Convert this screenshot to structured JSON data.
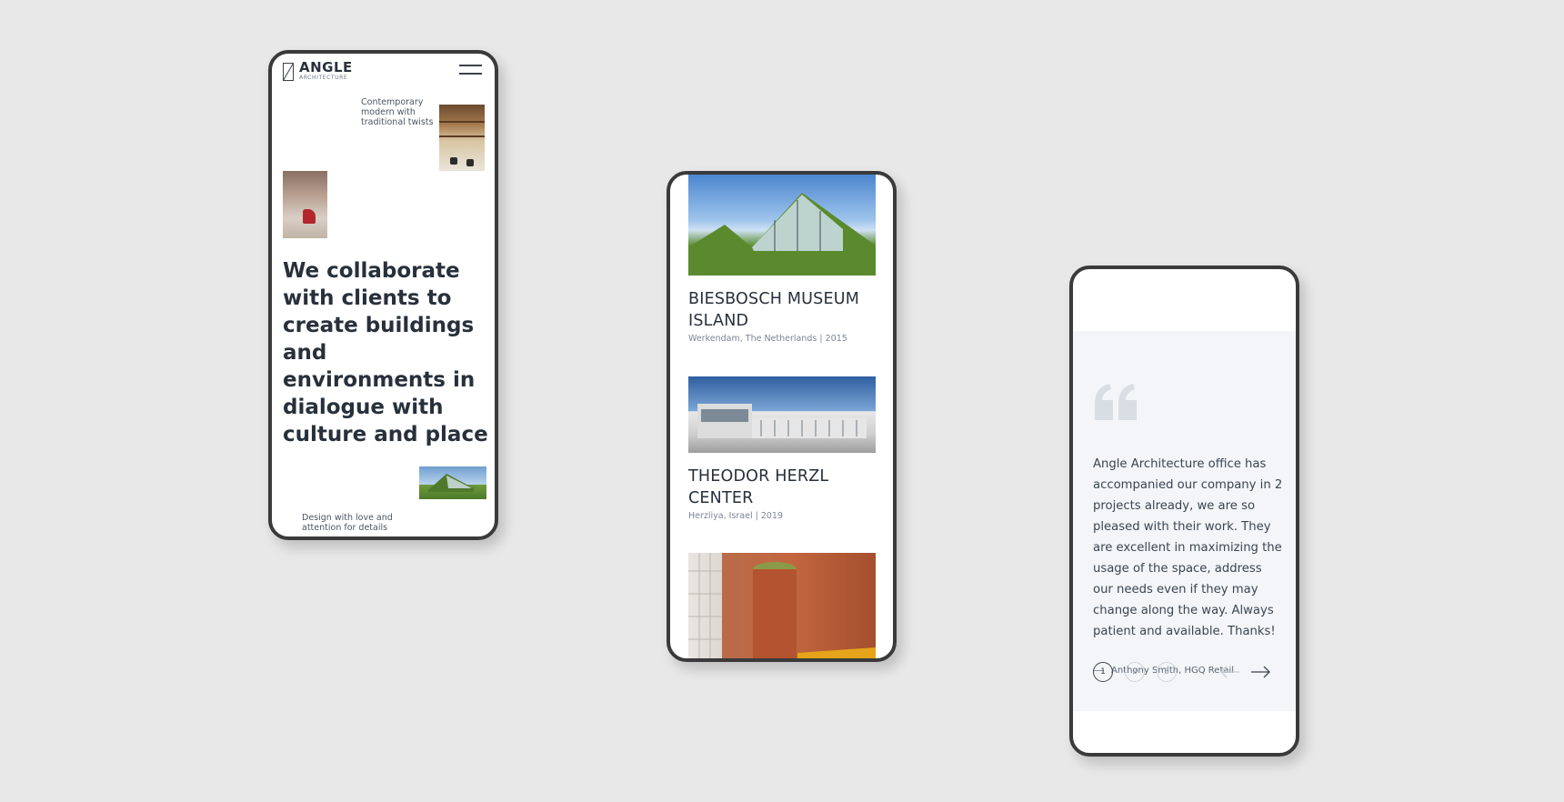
{
  "phone_home": {
    "logo": {
      "name": "ANGLE",
      "sub": "ARCHITECTURE"
    },
    "caption_top": "Contemporary modern with traditional twists",
    "headline": "We collaborate with clients to create buildings and environments in dialogue with culture and place",
    "caption_bottom": "Design with love and attention for details",
    "icons": {
      "menu": "hamburger-icon",
      "logo": "angle-logo-icon"
    }
  },
  "phone_projects": {
    "projects": [
      {
        "title": "BIESBOSCH MUSEUM ISLAND",
        "meta": "Werkendam, The Netherlands  |  2015"
      },
      {
        "title": "THEODOR HERZL CENTER",
        "meta": "Herzliya, Israel  |  2019"
      },
      {
        "title": "",
        "meta": ""
      }
    ]
  },
  "phone_testimonial": {
    "quote": "Angle Architecture office has accompanied our company in 2 projects already, we are so pleased with their work. They are excellent in maximizing the usage of the space, address our needs even if they may change along the way. Always patient and available. Thanks!",
    "author": "Anthony Smith, HGQ Retail",
    "pages": [
      "1",
      "2",
      "3"
    ],
    "active_page": "1",
    "icons": {
      "quote": "quote-mark-icon",
      "prev": "arrow-left-icon",
      "next": "arrow-right-icon"
    }
  },
  "colors": {
    "background": "#e8e8e8",
    "text_dark": "#27303b",
    "text_muted": "#7b8594",
    "quote_panel": "#f3f5f8",
    "frame": "#3a3a3a"
  }
}
